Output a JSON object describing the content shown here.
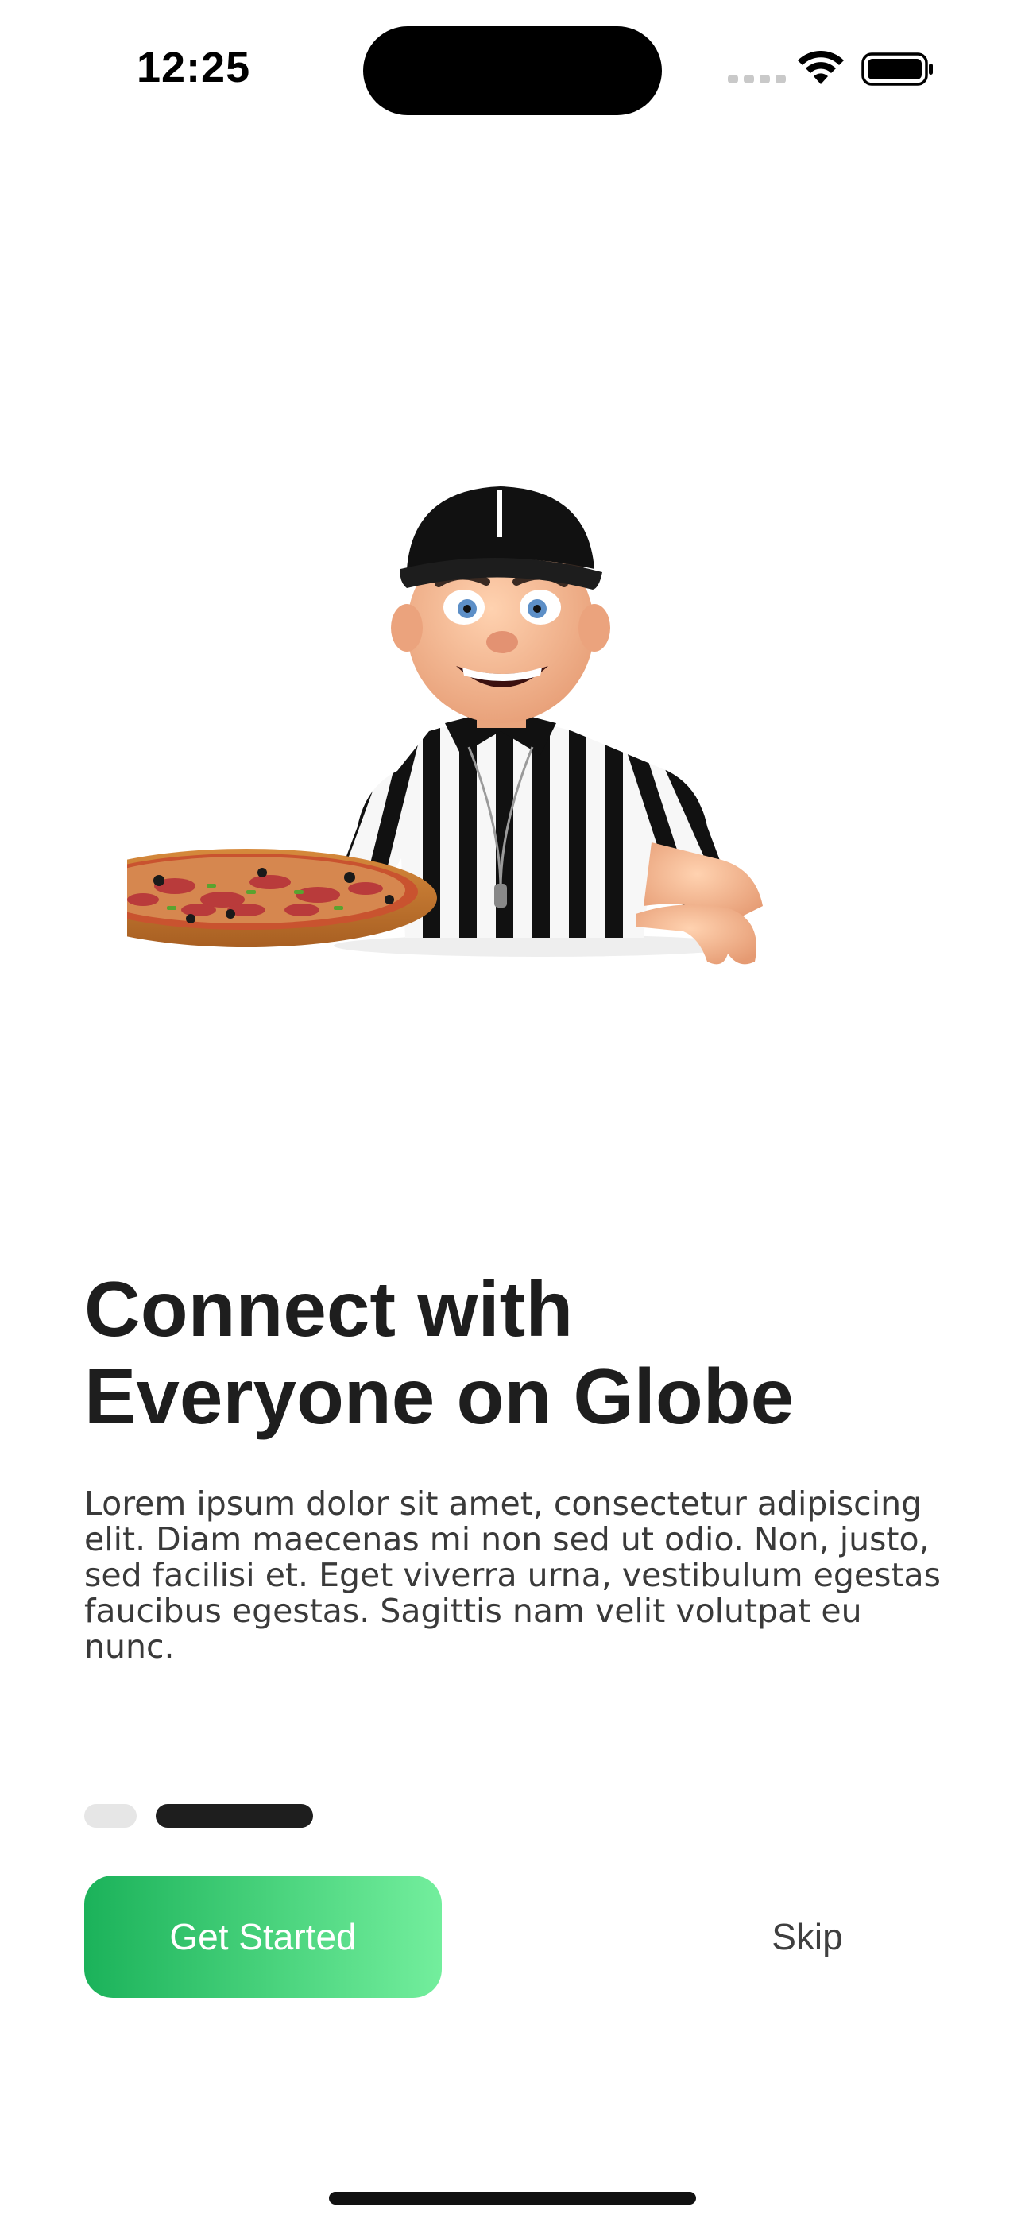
{
  "status_bar": {
    "time": "12:25",
    "icons": [
      "cellular-signal-icon",
      "wifi-icon",
      "battery-icon"
    ]
  },
  "illustration": {
    "icon": "referee-holding-pizza-illustration"
  },
  "onboarding": {
    "title_line1": "Connect with",
    "title_line2": "Everyone on Globe",
    "description": "Lorem ipsum dolor sit amet, consectetur adipiscing elit. Diam maecenas mi non sed ut odio. Non, justo, sed facilisi et. Eget viverra urna, vestibulum egestas faucibus egestas. Sagittis nam velit volutpat eu nunc.",
    "page_indicator": {
      "total_pages": 2,
      "current_page": 2
    }
  },
  "actions": {
    "primary_label": "Get Started",
    "skip_label": "Skip"
  },
  "colors": {
    "accent_start": "#1bb25a",
    "accent_end": "#73ee9d",
    "title": "#1e1e1e",
    "indicator_active": "#1e1e1e",
    "indicator_inactive": "#e6e6e6"
  }
}
